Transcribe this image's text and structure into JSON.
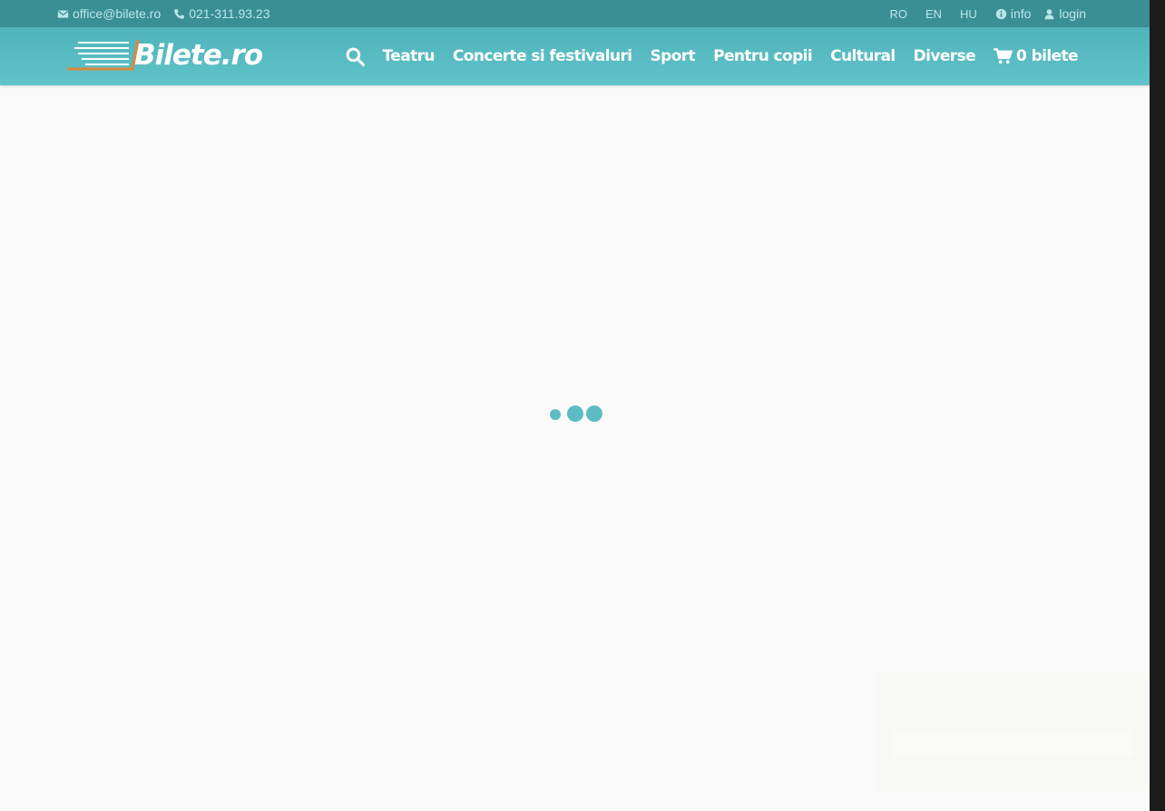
{
  "colors": {
    "topbar_bg": "#3a8f95",
    "header_bg": "#5bbcc3",
    "page_bg": "#fafafa",
    "accent": "#e0873a",
    "loader_dot": "#5dbcc3"
  },
  "topbar": {
    "email": {
      "icon": "envelope-icon",
      "text": "office@bilete.ro"
    },
    "phone": {
      "icon": "phone-icon",
      "text": "021-311.93.23"
    },
    "languages": [
      "RO",
      "EN",
      "HU"
    ],
    "info": {
      "icon": "info-circle-icon",
      "text": "info"
    },
    "login": {
      "icon": "user-icon",
      "text": "login"
    }
  },
  "header": {
    "logo_text": "Bilete.ro",
    "search_icon": "search-icon",
    "nav": [
      "Teatru",
      "Concerte si festivaluri",
      "Sport",
      "Pentru copii",
      "Cultural",
      "Diverse"
    ],
    "cart": {
      "icon": "shopping-cart-icon",
      "text": "0 bilete"
    }
  },
  "main": {
    "loader": "loading-dots"
  }
}
